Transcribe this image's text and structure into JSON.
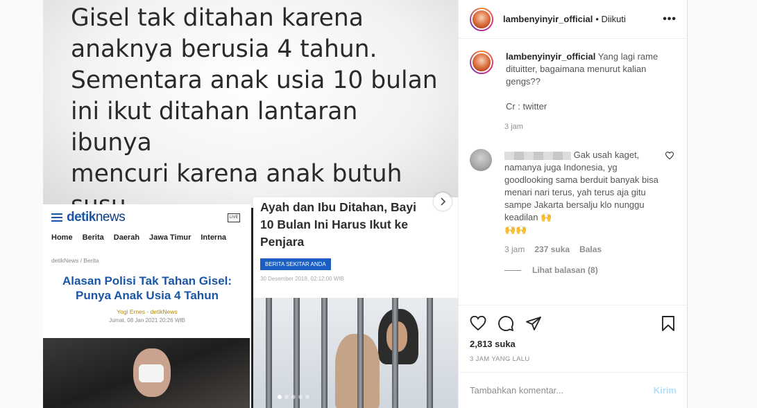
{
  "media": {
    "headline": "Gisel tak ditahan karena\nanaknya berusia 4 tahun.\nSementara anak usia 10 bulan\nini ikut ditahan lantaran ibunya\nmencuri karena anak butuh\nsusu.",
    "detik": {
      "logo_a": "detik",
      "logo_b": "news",
      "live": "LIVE",
      "nav": [
        "Home",
        "Berita",
        "Daerah",
        "Jawa Timur",
        "Interna"
      ],
      "crumb": "detikNews / Berita",
      "title": "Alasan Polisi Tak Tahan Gisel: Punya Anak Usia 4 Tahun",
      "author": "Yogi Ernes - detikNews",
      "date": "Jumat, 08 Jan 2021 20:26 WIB"
    },
    "right_news": {
      "title": "Ayah dan Ibu Ditahan, Bayi\n10 Bulan Ini Harus Ikut ke\nPenjara",
      "badge": "BERITA SEKITAR ANDA",
      "date": "30 Desember 2018, 02:12:00 WIB"
    },
    "next_icon": "chevron-right",
    "slide_count": 5,
    "active_slide": 1
  },
  "post": {
    "username": "lambenyinyir_official",
    "follow_status": "• Diikuti",
    "more_icon": "more-horizontal",
    "caption": {
      "username": "lambenyinyir_official",
      "text": "Yang lagi rame dituitter, bagaimana menurut kalian gengs??",
      "credit": "Cr : twitter",
      "time": "3 jam"
    },
    "comment": {
      "text": "Gak usah kaget, namanya juga Indonesia, yg goodlooking sama berduit banyak bisa menari nari terus, yah terus aja gitu sampe Jakarta bersalju klo nunggu keadilan 🙌",
      "emojis": "🙌🙌",
      "time": "3 jam",
      "likes": "237 suka",
      "reply": "Balas",
      "view_replies": "Lihat balasan (8)"
    },
    "likes": "2,813 suka",
    "ago": "3 JAM YANG LALU",
    "composer": {
      "placeholder": "Tambahkan komentar...",
      "post_label": "Kirim"
    }
  },
  "colors": {
    "instagram_blue_disabled": "#b2dffc",
    "detik_blue": "#1a56a8",
    "badge_blue": "#1a5ec4"
  }
}
